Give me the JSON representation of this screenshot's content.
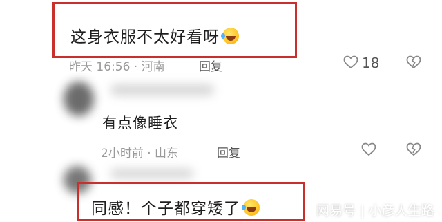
{
  "comments": [
    {
      "text": "这身衣服不太好看呀",
      "meta": "昨天 16:56 · 河南",
      "reply_label": "回复",
      "like_count": "18",
      "emoji": "laughing-crying-emoji"
    },
    {
      "text": "有点像睡衣",
      "meta": "2小时前 · 山东",
      "reply_label": "回复"
    },
    {
      "text": "同感！个子都穿矮了",
      "emoji": "laughing-crying-emoji"
    }
  ],
  "watermark": {
    "source": "网易号",
    "separator": "|",
    "author": "小彦人生路"
  },
  "colors": {
    "highlight_border": "#c9302c",
    "meta_text": "#9a9a9a"
  }
}
